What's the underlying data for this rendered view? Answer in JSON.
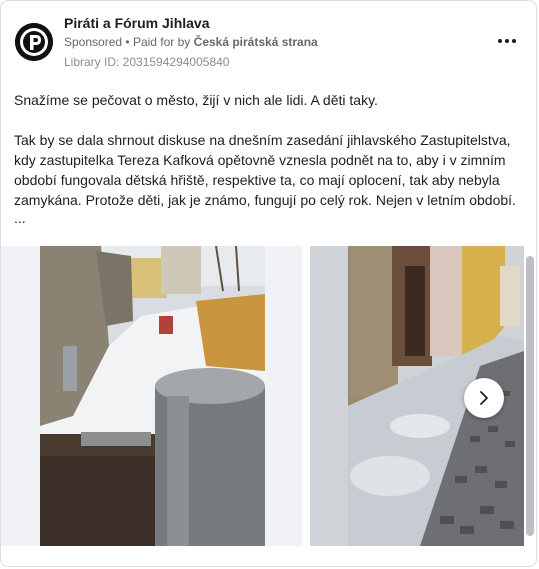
{
  "ad": {
    "page_name": "Piráti a Fórum Jihlava",
    "sponsored": "Sponsored",
    "separator": "•",
    "paid_for_by": "Paid for by",
    "sponsor": "Česká pirátská strana",
    "library_id": "Library ID: 2031594294005840",
    "icons": {
      "avatar": "pirate-party-logo",
      "more": "more-options-icon",
      "next": "chevron-right-icon"
    }
  },
  "body": {
    "paragraph1": "Snažíme se pečovat o město, žijí v nich ale lidi. A děti taky.",
    "paragraph2": "Tak by se dala shrnout diskuse na dnešním zasedání jihlavského Zastupitelstva, kdy zastupitelka Tereza Kafková opětovně vznesla podnět na to, aby i v zimním období fungovala dětská hřiště, respektive ta, co mají oplocení, tak aby nebyla zamykána. Protože děti, jak je známo, fungují po celý rok. Nejen v letním období.",
    "ellipsis": "..."
  },
  "colors": {
    "text": "#1c1e21",
    "secondary": "#65676b",
    "border": "#dadde1"
  }
}
